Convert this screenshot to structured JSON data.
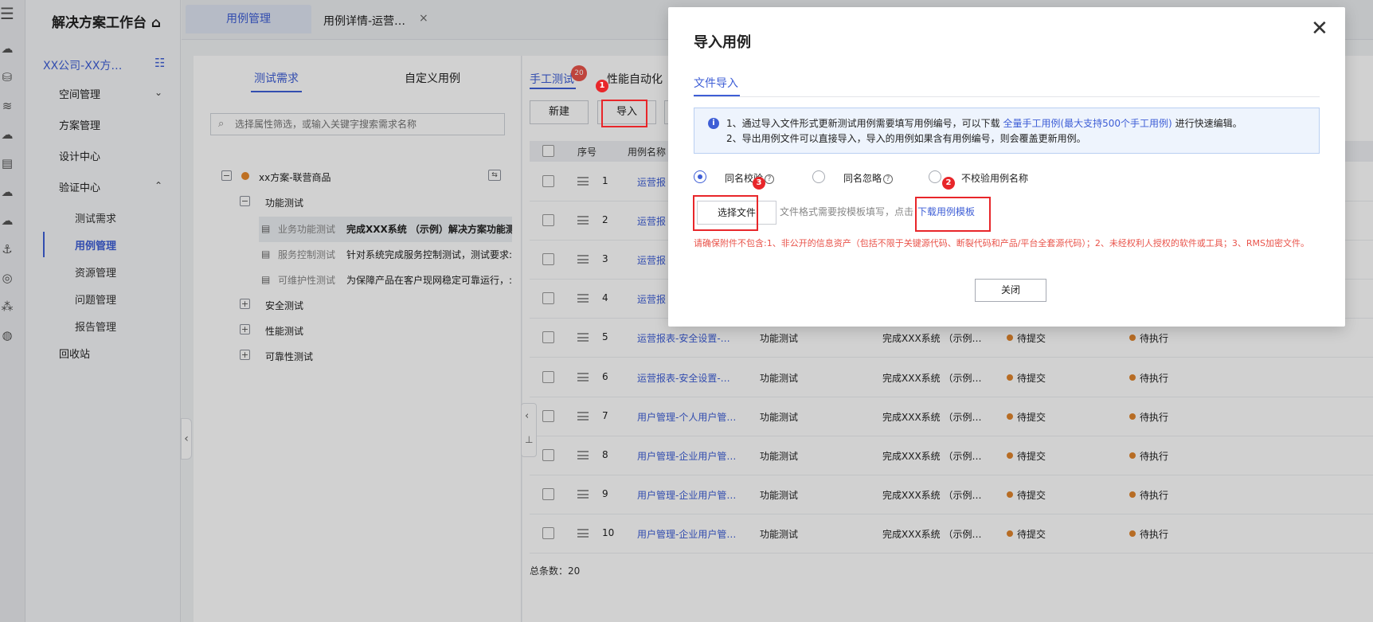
{
  "colors": {
    "accent": "#3e5ed6",
    "annotation": "#e8262a",
    "warning": "#e9534a",
    "status_orange": "#e0842c"
  },
  "rail_icons": [
    "menu-icon",
    "cloud-icon",
    "database-icon",
    "wave-icon",
    "cloud-upload-icon",
    "document-icon",
    "cloud-icon",
    "cloud-sync-icon",
    "anchor-icon",
    "badge-icon",
    "network-icon",
    "globe-icon"
  ],
  "nav": {
    "title": "解决方案工作台",
    "org": "XX公司-XX方…",
    "items": [
      "空间管理",
      "方案管理",
      "设计中心",
      "验证中心"
    ],
    "subitems": [
      "测试需求",
      "用例管理",
      "资源管理",
      "问题管理",
      "报告管理"
    ],
    "recycle": "回收站"
  },
  "tabs": {
    "tab1": "用例管理",
    "tab2": "用例详情-运营…",
    "close": "×"
  },
  "left": {
    "tab_a": "测试需求",
    "tab_b": "自定义用例",
    "search_placeholder": "选择属性筛选，或输入关键字搜索需求名称",
    "root": "xx方案-联营商品",
    "node_func": "功能测试",
    "func_children": [
      {
        "name": "业务功能测试",
        "desc": "完成XXX系统 （示例）解决方案功能测"
      },
      {
        "name": "服务控制测试",
        "desc": "针对系统完成服务控制测试，测试要求:"
      },
      {
        "name": "可维护性测试",
        "desc": "为保障产品在客户现网稳定可靠运行，:"
      }
    ],
    "nodes": [
      "安全测试",
      "性能测试",
      "可靠性测试"
    ]
  },
  "right": {
    "tab_manual": "手工测试",
    "badge": "20",
    "tab_perf": "性能自动化",
    "btn_new": "新建",
    "btn_import": "导入",
    "col_index": "序号",
    "col_name": "用例名称",
    "rows": [
      {
        "n": "1",
        "name": "运营报",
        "type": "",
        "req": "",
        "s1": "",
        "s2": ""
      },
      {
        "n": "2",
        "name": "运营报",
        "type": "",
        "req": "",
        "s1": "",
        "s2": ""
      },
      {
        "n": "3",
        "name": "运营报",
        "type": "",
        "req": "",
        "s1": "",
        "s2": ""
      },
      {
        "n": "4",
        "name": "运营报",
        "type": "",
        "req": "",
        "s1": "",
        "s2": ""
      },
      {
        "n": "5",
        "name": "运营报表-安全设置-…",
        "type": "功能测试",
        "req": "完成XXX系统 （示例…",
        "s1": "待提交",
        "s2": "待执行"
      },
      {
        "n": "6",
        "name": "运营报表-安全设置-…",
        "type": "功能测试",
        "req": "完成XXX系统 （示例…",
        "s1": "待提交",
        "s2": "待执行"
      },
      {
        "n": "7",
        "name": "用户管理-个人用户管…",
        "type": "功能测试",
        "req": "完成XXX系统 （示例…",
        "s1": "待提交",
        "s2": "待执行"
      },
      {
        "n": "8",
        "name": "用户管理-企业用户管…",
        "type": "功能测试",
        "req": "完成XXX系统 （示例…",
        "s1": "待提交",
        "s2": "待执行"
      },
      {
        "n": "9",
        "name": "用户管理-企业用户管…",
        "type": "功能测试",
        "req": "完成XXX系统 （示例…",
        "s1": "待提交",
        "s2": "待执行"
      },
      {
        "n": "10",
        "name": "用户管理-企业用户管…",
        "type": "功能测试",
        "req": "完成XXX系统 （示例…",
        "s1": "待提交",
        "s2": "待执行"
      }
    ],
    "total": "总条数：20"
  },
  "dialog": {
    "title": "导入用例",
    "close": "✕",
    "tab": "文件导入",
    "info_line1_a": "1、通过导入文件形式更新测试用例需要填写用例编号，可以下载",
    "info_line1_link": "全量手工用例(最大支持500个手工用例)",
    "info_line1_b": "进行快速编辑。",
    "info_line2": "2、导出用例文件可以直接导入，导入的用例如果含有用例编号，则会覆盖更新用例。",
    "radio1": "同名校验",
    "radio2": "同名忽略",
    "radio3": "不校验用例名称",
    "help": "?",
    "file_button": "选择文件",
    "file_hint": "文件格式需要按模板填写，点击",
    "file_link": "下载用例模板",
    "warning": "请确保附件不包含:1、非公开的信息资产（包括不限于关键源代码、断裂代码和产品/平台全套源代码）；2、未经权利人授权的软件或工具；3、RMS加密文件。",
    "close_button": "关闭"
  },
  "annotations": [
    "1",
    "2",
    "3"
  ]
}
